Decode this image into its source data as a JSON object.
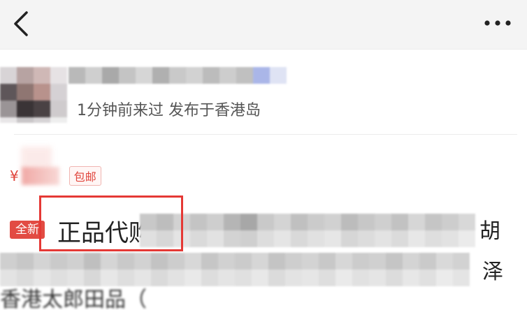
{
  "nav": {
    "back_icon": "chevron-left-icon",
    "more_icon": "more-horizontal-icon"
  },
  "seller": {
    "meta_text": "1分钟前来过 发布于香港岛"
  },
  "listing": {
    "currency": "¥",
    "shipping_tag": "包邮",
    "condition_badge": "全新",
    "title_visible": "正品代购",
    "title_tail_char_1": "胡",
    "title_tail_char_2": "泽",
    "title_line3_partial": "香港太郎田品（"
  },
  "colors": {
    "accent_red": "#e0443b",
    "nav_bg": "#f4f4f4",
    "highlight_border": "#e53935"
  }
}
